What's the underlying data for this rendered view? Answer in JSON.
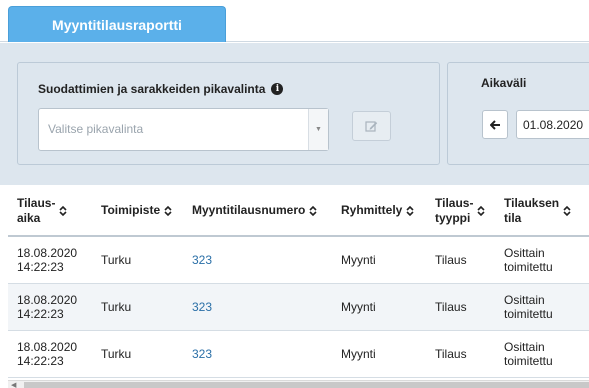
{
  "tabs": [
    {
      "label": "Myyntitilausraportti",
      "active": true
    }
  ],
  "filter": {
    "quick_select_title": "Suodattimien ja sarakkeiden pikavalinta",
    "info_icon": "info-circle-icon",
    "quick_select_placeholder": "Valitse pikavalinta",
    "edit_icon": "pencil-square-icon"
  },
  "date_range": {
    "title": "Aikaväli",
    "back_icon": "arrow-left-icon",
    "start_date": "01.08.2020"
  },
  "table": {
    "columns": [
      {
        "line1": "Tilaus-",
        "line2": "aika"
      },
      {
        "line1": "Toimipiste",
        "line2": ""
      },
      {
        "line1": "Myyntitilausnumero",
        "line2": ""
      },
      {
        "line1": "Ryhmittely",
        "line2": ""
      },
      {
        "line1": "Tilaus-",
        "line2": "tyyppi"
      },
      {
        "line1": "Tilauksen",
        "line2": "tila"
      }
    ],
    "rows": [
      {
        "date": "18.08.2020",
        "time": "14:22:23",
        "location": "Turku",
        "order_number": "323",
        "grouping": "Myynti",
        "type": "Tilaus",
        "status1": "Osittain",
        "status2": "toimitettu"
      },
      {
        "date": "18.08.2020",
        "time": "14:22:23",
        "location": "Turku",
        "order_number": "323",
        "grouping": "Myynti",
        "type": "Tilaus",
        "status1": "Osittain",
        "status2": "toimitettu"
      },
      {
        "date": "18.08.2020",
        "time": "14:22:23",
        "location": "Turku",
        "order_number": "323",
        "grouping": "Myynti",
        "type": "Tilaus",
        "status1": "Osittain",
        "status2": "toimitettu"
      }
    ]
  },
  "colors": {
    "tab_active": "#5bb0ea",
    "filter_background": "#dde6ee",
    "link": "#2a6fa7"
  }
}
